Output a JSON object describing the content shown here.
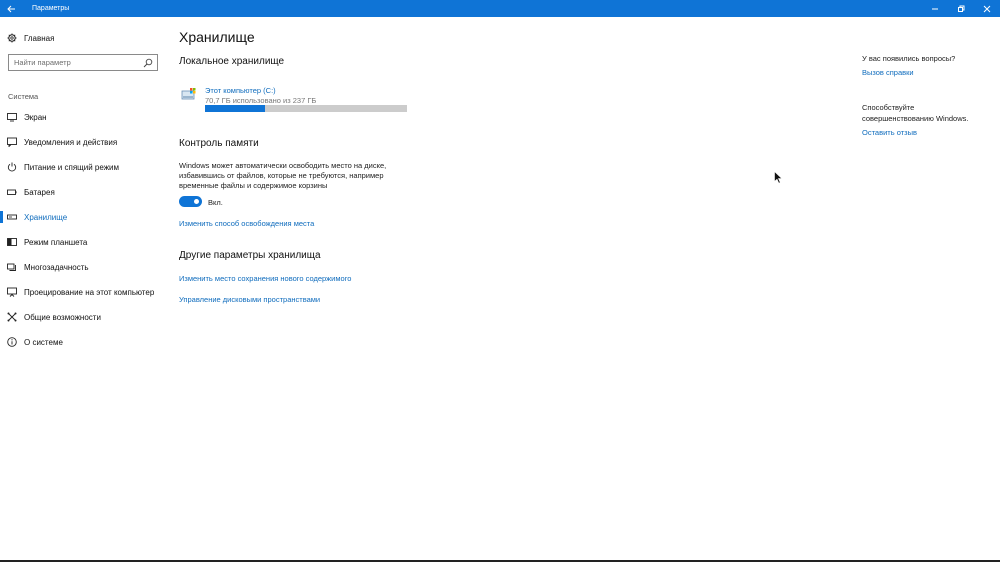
{
  "window": {
    "title": "Параметры",
    "back_icon": "back-arrow-icon",
    "controls": [
      "minimize-icon",
      "restore-icon",
      "close-icon"
    ]
  },
  "sidebar": {
    "home_label": "Главная",
    "search_placeholder": "Найти параметр",
    "section_label": "Система",
    "items": [
      {
        "label": "Экран",
        "icon": "monitor-icon"
      },
      {
        "label": "Уведомления и действия",
        "icon": "notification-icon"
      },
      {
        "label": "Питание и спящий режим",
        "icon": "power-icon"
      },
      {
        "label": "Батарея",
        "icon": "battery-icon"
      },
      {
        "label": "Хранилище",
        "icon": "storage-icon",
        "active": true
      },
      {
        "label": "Режим планшета",
        "icon": "tablet-icon"
      },
      {
        "label": "Многозадачность",
        "icon": "multitask-icon"
      },
      {
        "label": "Проецирование на этот компьютер",
        "icon": "project-icon"
      },
      {
        "label": "Общие возможности",
        "icon": "shared-icon"
      },
      {
        "label": "О системе",
        "icon": "info-icon"
      }
    ]
  },
  "main": {
    "title": "Хранилище",
    "local_storage": {
      "heading": "Локальное хранилище",
      "drive_name": "Этот компьютер (C:)",
      "drive_usage": "70,7 ГБ использовано из 237 ГБ",
      "used_fraction": 0.298
    },
    "storage_sense": {
      "heading": "Контроль памяти",
      "description": "Windows может автоматически освободить место на диске, избавившись от файлов, которые не требуются, например временные файлы и содержимое корзины",
      "toggle_label": "Вкл.",
      "toggle_on": true,
      "change_link": "Изменить способ освобождения места"
    },
    "other": {
      "heading": "Другие параметры хранилища",
      "link_save_location": "Изменить место сохранения нового содержимого",
      "link_disk_spaces": "Управление дисковыми пространствами"
    }
  },
  "right_panel": {
    "question": "У вас появились вопросы?",
    "help_link": "Вызов справки",
    "improve_line1": "Способствуйте",
    "improve_line2": "совершенствованию Windows.",
    "feedback_link": "Оставить отзыв"
  },
  "colors": {
    "accent": "#0f74d6",
    "link": "#0f6cbd",
    "bar_bg": "#cccccc"
  }
}
